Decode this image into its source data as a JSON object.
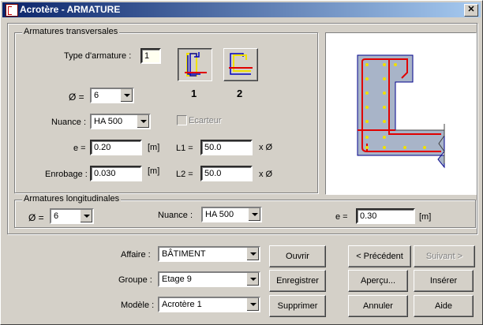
{
  "window": {
    "title": "Acrotère - ARMATURE",
    "close_glyph": "✕"
  },
  "transversal": {
    "legend": "Armatures transversales",
    "type_label": "Type d'armature :",
    "type_value": "1",
    "type_options": [
      {
        "label": "1"
      },
      {
        "label": "2"
      }
    ],
    "diameter_label": "Ø =",
    "diameter_value": "6",
    "nuance_label": "Nuance :",
    "nuance_value": "HA 500",
    "ecarteur_label": "Ecarteur",
    "e_label": "e =",
    "e_value": "0.20",
    "e_unit": "[m]",
    "enrobage_label": "Enrobage :",
    "enrobage_value": "0.030",
    "enrobage_unit": "[m]",
    "l1_label": "L1 =",
    "l1_value": "50.0",
    "l1_unit": "x Ø",
    "l2_label": "L2 =",
    "l2_value": "50.0",
    "l2_unit": "x Ø"
  },
  "longitudinal": {
    "legend": "Armatures longitudinales",
    "diameter_label": "Ø =",
    "diameter_value": "6",
    "nuance_label": "Nuance :",
    "nuance_value": "HA 500",
    "e_label": "e =",
    "e_value": "0.30",
    "e_unit": "[m]"
  },
  "footer": {
    "affaire_label": "Affaire :",
    "affaire_value": "BÂTIMENT",
    "groupe_label": "Groupe :",
    "groupe_value": "Etage 9",
    "modele_label": "Modèle :",
    "modele_value": "Acrotère 1",
    "buttons": {
      "ouvrir": "Ouvrir",
      "enregistrer": "Enregistrer",
      "supprimer": "Supprimer",
      "precedent": "< Précédent",
      "suivant": "Suivant >",
      "apercu": "Aperçu...",
      "inserer": "Insérer",
      "annuler": "Annuler",
      "aide": "Aide"
    }
  },
  "colors": {
    "rebar": "#e00000",
    "dots": "#f0e000",
    "concrete": "#a8b4c8",
    "stirrup_blue": "#0000c0"
  }
}
